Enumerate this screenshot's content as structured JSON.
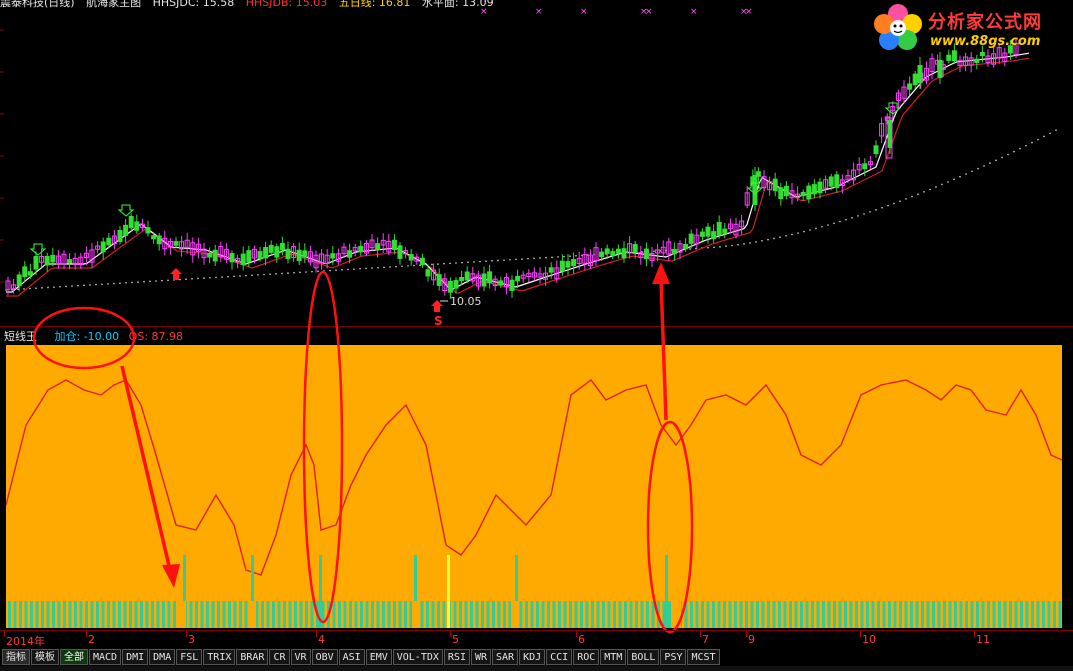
{
  "header": {
    "stock": "震泰科技(日线)",
    "chart_name": "航海家主图",
    "hhsjdc": "HHSJDC: 15.58",
    "hhsjdb": "HHSJDB: 15.03",
    "five_day": "五日线: 16.81",
    "water": "水平面: 13.09"
  },
  "logo": {
    "text": "分析家公式网",
    "url": "www.88gs.com"
  },
  "main": {
    "low_label": "10.05",
    "signal_b": "B",
    "signal_s": "S"
  },
  "indicator": {
    "name": "短线王",
    "jiacang": "加仓: -10.00",
    "qs": "QS: 87.98",
    "bg_color": "#ffaa00",
    "line_color": "#e02020"
  },
  "date_axis": [
    "2014年",
    "2",
    "3",
    "4",
    "5",
    "6",
    "7",
    "9",
    "10",
    "11"
  ],
  "tabs": [
    "指标",
    "模板",
    "全部",
    "MACD",
    "DMI",
    "DMA",
    "FSL",
    "TRIX",
    "BRAR",
    "CR",
    "VR",
    "OBV",
    "ASI",
    "EMV",
    "VOL-TDX",
    "RSI",
    "WR",
    "SAR",
    "KDJ",
    "CCI",
    "ROC",
    "MTM",
    "BOLL",
    "PSY",
    "MCST"
  ],
  "colors": {
    "up_candle": "#ff40ff",
    "down_candle": "#33dd33",
    "ma_white": "#ffffff",
    "ma_red": "#d02020",
    "annotation": "#ff1010"
  }
}
